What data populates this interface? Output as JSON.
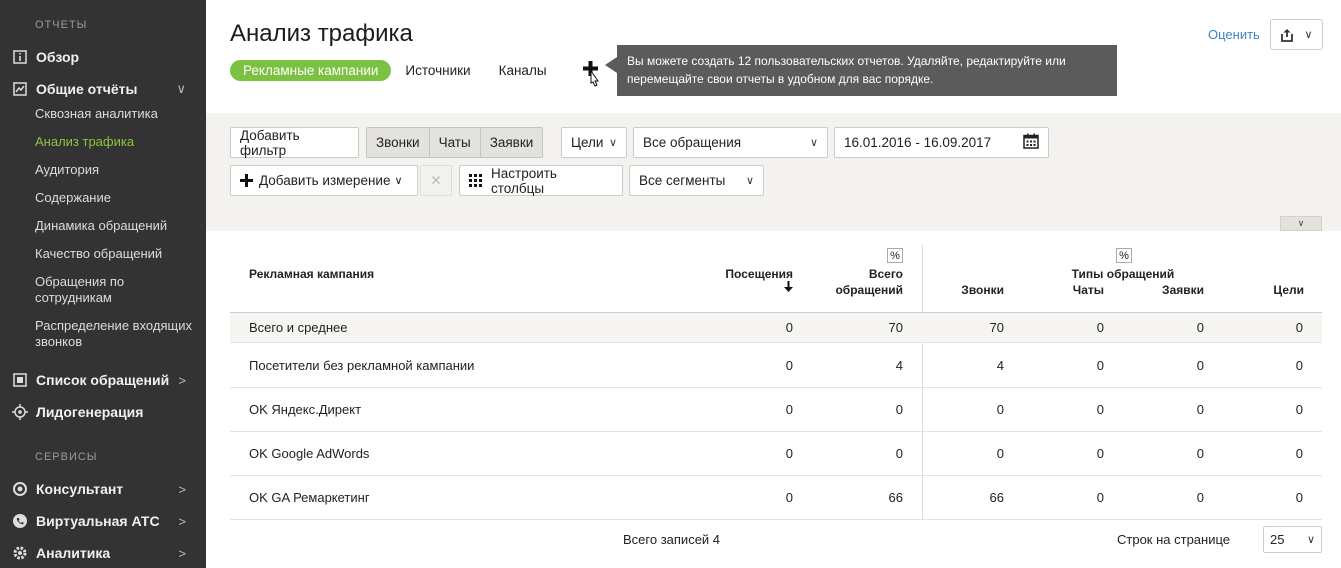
{
  "sidebar": {
    "section_reports": "ОТЧЕТЫ",
    "overview": "Обзор",
    "general_reports": "Общие отчёты",
    "sub_items": [
      "Сквозная аналитика",
      "Анализ трафика",
      "Аудитория",
      "Содержание",
      "Динамика обращений",
      "Качество обращений",
      "Обращения по сотрудникам",
      "Распределение входящих звонков"
    ],
    "active_sub": "Анализ трафика",
    "requests_list": "Список обращений",
    "lead_generation": "Лидогенерация",
    "section_services": "СЕРВИСЫ",
    "consultant": "Консультант",
    "virtual_pbx": "Виртуальная АТС",
    "analytics": "Аналитика"
  },
  "header": {
    "title": "Анализ трафика",
    "tabs": [
      "Рекламные кампании",
      "Источники",
      "Каналы"
    ],
    "tooltip": "Вы можете создать 12 пользовательских отчетов. Удаляйте, редактируйте или перемещайте свои отчеты в удобном для вас порядке.",
    "rate_link": "Оценить"
  },
  "filters": {
    "add_filter": "Добавить фильтр",
    "segments": [
      "Звонки",
      "Чаты",
      "Заявки"
    ],
    "goals": "Цели",
    "requests_select": "Все обращения",
    "date_range": "16.01.2016 - 16.09.2017",
    "add_dimension": "Добавить измерение",
    "configure_columns": "Настроить столбцы",
    "all_segments": "Все сегменты"
  },
  "table": {
    "col_campaign": "Рекламная кампания",
    "col_visits": "Посещения",
    "col_total_line1": "Всего",
    "col_total_line2": "обращений",
    "pct": "%",
    "group_types": "Типы обращений",
    "col_calls": "Звонки",
    "col_chats": "Чаты",
    "col_requests": "Заявки",
    "col_goals": "Цели",
    "rows": [
      {
        "name": "Всего и среднее",
        "visits": "0",
        "total": "70",
        "calls": "70",
        "chats": "0",
        "requests": "0",
        "goals": "0"
      },
      {
        "name": "Посетители без рекламной кампании",
        "visits": "0",
        "total": "4",
        "calls": "4",
        "chats": "0",
        "requests": "0",
        "goals": "0"
      },
      {
        "name": "OK Яндекс.Директ",
        "visits": "0",
        "total": "0",
        "calls": "0",
        "chats": "0",
        "requests": "0",
        "goals": "0"
      },
      {
        "name": "OK Google AdWords",
        "visits": "0",
        "total": "0",
        "calls": "0",
        "chats": "0",
        "requests": "0",
        "goals": "0"
      },
      {
        "name": "OK GA Ремаркетинг",
        "visits": "0",
        "total": "66",
        "calls": "66",
        "chats": "0",
        "requests": "0",
        "goals": "0"
      }
    ]
  },
  "footer": {
    "total_records": "Всего записей 4",
    "rows_per_page_label": "Строк на странице",
    "rows_per_page_value": "25"
  },
  "colors": {
    "accent": "#7cc242",
    "sidebar_bg": "#333333",
    "tooltip_bg": "#5b5b5b",
    "filter_band_bg": "#f3f2ee"
  }
}
